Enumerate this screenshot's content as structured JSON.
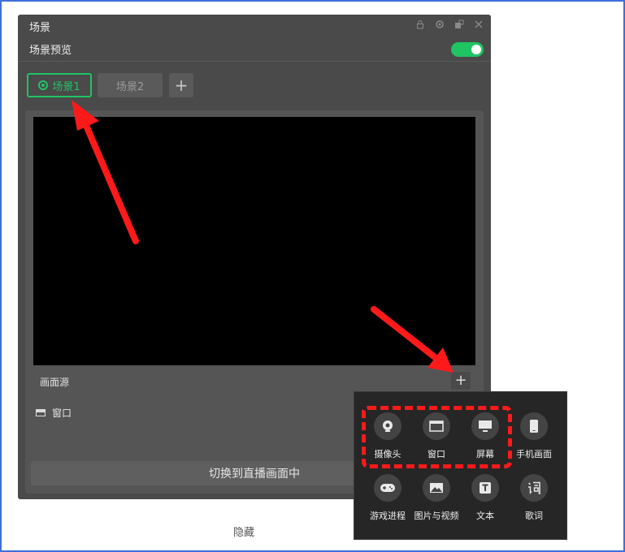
{
  "panel": {
    "title": "场景",
    "preview_label": "场景预览",
    "preview_enabled": true
  },
  "tabs": [
    {
      "label": "场景1",
      "active": true
    },
    {
      "label": "场景2",
      "active": false
    }
  ],
  "tab_add_label": "+",
  "sources": {
    "header": "画面源",
    "add_label": "+",
    "items": [
      {
        "label": "窗口"
      }
    ]
  },
  "switch_button": "切换到直播画面中",
  "hide_label": "隐藏",
  "source_menu": [
    {
      "label": "摄像头",
      "icon": "camera-icon"
    },
    {
      "label": "窗口",
      "icon": "window-icon"
    },
    {
      "label": "屏幕",
      "icon": "monitor-icon"
    },
    {
      "label": "手机画面",
      "icon": "phone-icon"
    },
    {
      "label": "游戏进程",
      "icon": "gamepad-icon"
    },
    {
      "label": "图片与视频",
      "icon": "image-icon"
    },
    {
      "label": "文本",
      "icon": "text-icon"
    },
    {
      "label": "歌词",
      "icon": "lyrics-icon"
    }
  ],
  "colors": {
    "accent": "#1fc463",
    "annotation": "#ff1a1a",
    "frame_border": "#3f6fd9"
  }
}
